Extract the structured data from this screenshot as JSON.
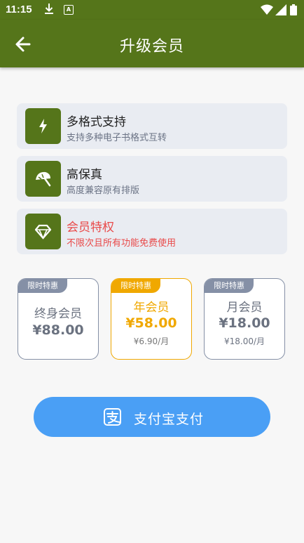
{
  "status_bar": {
    "time": "11:15",
    "app_letter": "A"
  },
  "header": {
    "title": "升级会员"
  },
  "features": [
    {
      "title": "多格式支持",
      "subtitle": "支持多种电子书格式互转",
      "icon": "lightning-icon"
    },
    {
      "title": "高保真",
      "subtitle": "高度兼容原有排版",
      "icon": "umbrella-icon"
    },
    {
      "title": "会员特权",
      "subtitle": "不限次且所有功能免费使用",
      "icon": "diamond-icon"
    }
  ],
  "plans": [
    {
      "tag": "限时特惠",
      "name": "终身会员",
      "price": "¥88.00",
      "per": ""
    },
    {
      "tag": "限时特惠",
      "name": "年会员",
      "price": "¥58.00",
      "per": "¥6.90/月",
      "selected": true
    },
    {
      "tag": "限时特惠",
      "name": "月会员",
      "price": "¥18.00",
      "per": "¥18.00/月"
    }
  ],
  "pay_button": {
    "label": "支付宝支付",
    "icon": "alipay-icon"
  },
  "colors": {
    "primary": "#55751a",
    "accent": "#f0a800",
    "pay": "#4a9ff5",
    "vip_text": "#e94a4a"
  }
}
